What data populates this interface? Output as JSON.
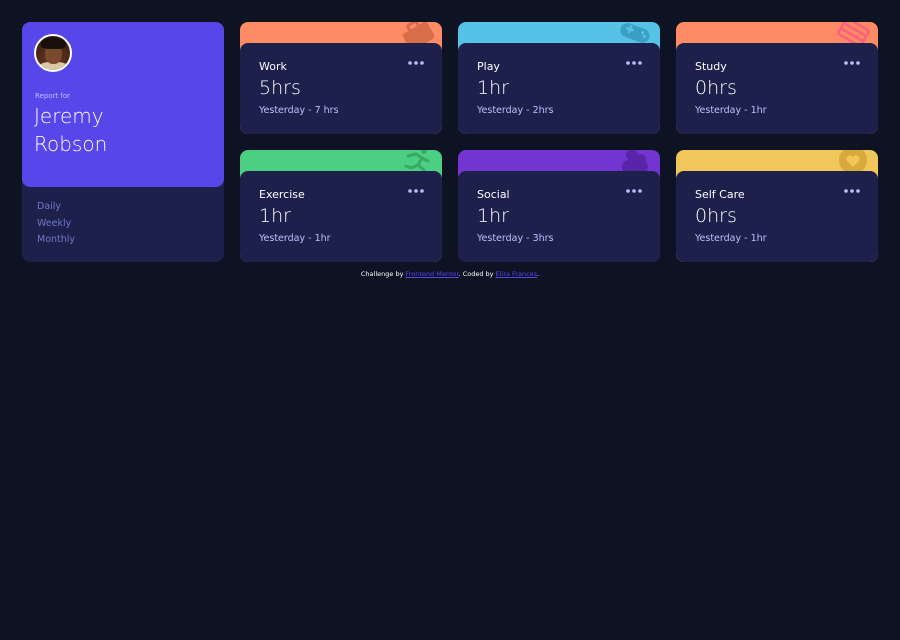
{
  "profile": {
    "report_for": "Report for",
    "first_name": "Jeremy",
    "last_name": "Robson",
    "avatar_icon": "user-avatar"
  },
  "periods": [
    "Daily",
    "Weekly",
    "Monthly"
  ],
  "activities": [
    {
      "title": "Work",
      "current": "5hrs",
      "previous": "Yesterday - 7 hrs",
      "color": "#ff8b64",
      "icon": "briefcase-icon"
    },
    {
      "title": "Play",
      "current": "1hr",
      "previous": "Yesterday - 2hrs",
      "color": "#55c2e6",
      "icon": "gamepad-icon"
    },
    {
      "title": "Study",
      "current": "0hrs",
      "previous": "Yesterday - 1hr",
      "color": "#ff5e7d",
      "icon": "book-icon"
    },
    {
      "title": "Exercise",
      "current": "1hr",
      "previous": "Yesterday - 1hr",
      "color": "#4bcf82",
      "icon": "running-icon"
    },
    {
      "title": "Social",
      "current": "1hr",
      "previous": "Yesterday - 3hrs",
      "color": "#7335d2",
      "icon": "social-icon"
    },
    {
      "title": "Self Care",
      "current": "0hrs",
      "previous": "Yesterday - 1hr",
      "color": "#f1c75b",
      "icon": "heart-icon"
    }
  ],
  "footer": {
    "prefix": "Challenge by ",
    "link1": "Frontend Mentor",
    "middle": ". Coded by ",
    "link2": "Elira Frances",
    "suffix": "."
  },
  "colors": {
    "background": "#0d1323",
    "card": "#1c204b",
    "accent": "#5747ea",
    "muted": "#7078c9",
    "pale": "#bbc0ff"
  }
}
